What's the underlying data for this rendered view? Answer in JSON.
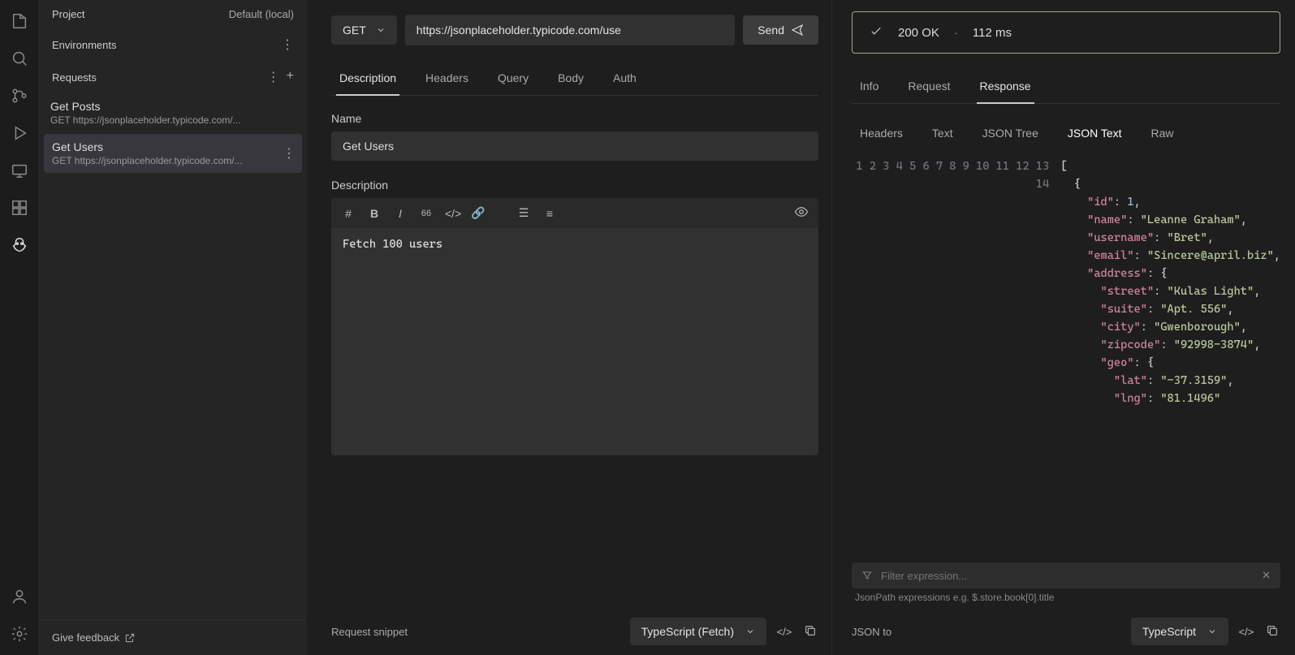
{
  "sidebar": {
    "project_label": "Project",
    "project_value": "Default (local)",
    "environments_label": "Environments",
    "requests_label": "Requests",
    "items": [
      {
        "title": "Get Posts",
        "sub": "GET https://jsonplaceholder.typicode.com/..."
      },
      {
        "title": "Get Users",
        "sub": "GET https://jsonplaceholder.typicode.com/..."
      }
    ],
    "feedback": "Give feedback"
  },
  "request": {
    "method": "GET",
    "url": "https://jsonplaceholder.typicode.com/use",
    "send": "Send",
    "tabs": [
      "Description",
      "Headers",
      "Query",
      "Body",
      "Auth"
    ],
    "active_tab": 0,
    "name_label": "Name",
    "name_value": "Get Users",
    "desc_label": "Description",
    "desc_value": "Fetch 100 users",
    "snippet_label": "Request snippet",
    "snippet_lang": "TypeScript (Fetch)"
  },
  "response": {
    "status_code": "200 OK",
    "time": "112 ms",
    "tabs": [
      "Info",
      "Request",
      "Response"
    ],
    "active_tab": 2,
    "subtabs": [
      "Headers",
      "Text",
      "JSON Tree",
      "JSON Text",
      "Raw"
    ],
    "active_subtab": 3,
    "json_lines": [
      {
        "t": "[",
        "i": 0
      },
      {
        "t": "{",
        "i": 1
      },
      {
        "k": "id",
        "v": 1,
        "i": 2,
        "num": true,
        "c": true
      },
      {
        "k": "name",
        "v": "Leanne Graham",
        "i": 2,
        "c": true
      },
      {
        "k": "username",
        "v": "Bret",
        "i": 2,
        "c": true
      },
      {
        "k": "email",
        "v": "Sincere@april.biz",
        "i": 2,
        "c": true
      },
      {
        "k": "address",
        "open": "{",
        "i": 2
      },
      {
        "k": "street",
        "v": "Kulas Light",
        "i": 3,
        "c": true
      },
      {
        "k": "suite",
        "v": "Apt. 556",
        "i": 3,
        "c": true
      },
      {
        "k": "city",
        "v": "Gwenborough",
        "i": 3,
        "c": true
      },
      {
        "k": "zipcode",
        "v": "92998-3874",
        "i": 3,
        "c": true
      },
      {
        "k": "geo",
        "open": "{",
        "i": 3
      },
      {
        "k": "lat",
        "v": "-37.3159",
        "i": 4,
        "c": true
      },
      {
        "k": "lng",
        "v": "81.1496",
        "i": 4
      }
    ],
    "filter_placeholder": "Filter expression...",
    "filter_hint": "JsonPath expressions e.g. $.store.book[0].title",
    "json_to_label": "JSON to",
    "json_to_lang": "TypeScript"
  }
}
